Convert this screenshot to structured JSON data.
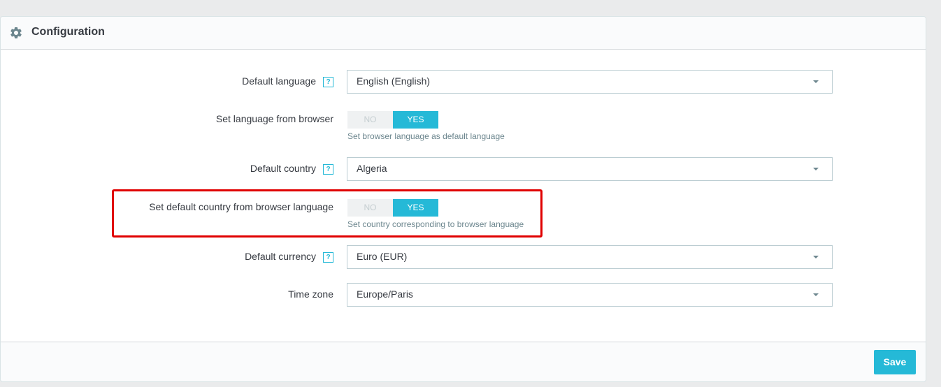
{
  "panel": {
    "title": "Configuration",
    "icon": "gear-icon"
  },
  "fields": {
    "default_language": {
      "label": "Default language",
      "help": "?",
      "value": "English (English)"
    },
    "language_from_browser": {
      "label": "Set language from browser",
      "no": "NO",
      "yes": "YES",
      "selected": "YES",
      "hint": "Set browser language as default language"
    },
    "default_country": {
      "label": "Default country",
      "help": "?",
      "value": "Algeria"
    },
    "country_from_browser": {
      "label": "Set default country from browser language",
      "no": "NO",
      "yes": "YES",
      "selected": "YES",
      "hint": "Set country corresponding to browser language"
    },
    "default_currency": {
      "label": "Default currency",
      "help": "?",
      "value": "Euro (EUR)"
    },
    "time_zone": {
      "label": "Time zone",
      "value": "Europe/Paris"
    }
  },
  "footer": {
    "save_label": "Save"
  },
  "colors": {
    "accent": "#25b9d7",
    "highlight": "#e00000",
    "toggle_off": "#eff1f2"
  }
}
